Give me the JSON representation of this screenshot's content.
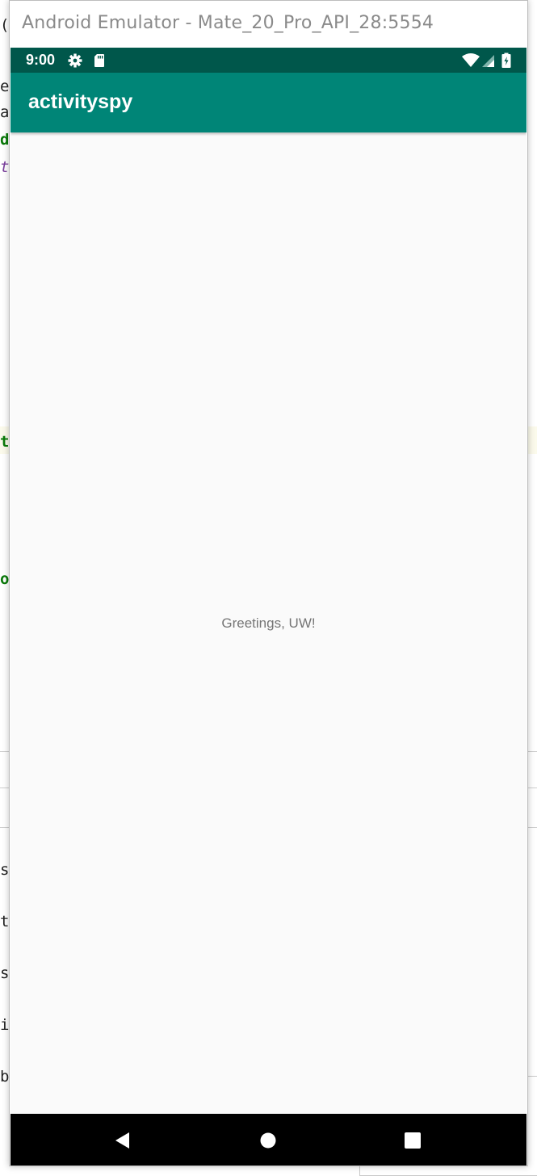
{
  "emulator": {
    "window_title": "Android Emulator - Mate_20_Pro_API_28:5554"
  },
  "status_bar": {
    "time": "9:00",
    "icons_left": [
      "settings-icon",
      "sd-card-icon"
    ],
    "icons_right": [
      "wifi-icon",
      "signal-icon",
      "battery-icon"
    ],
    "color": "#00574b"
  },
  "app_bar": {
    "title": "activityspy",
    "color": "#008577"
  },
  "content": {
    "greeting": "Greetings, UW!"
  },
  "nav_bar": {
    "buttons": [
      "back-icon",
      "home-icon",
      "overview-icon"
    ]
  }
}
